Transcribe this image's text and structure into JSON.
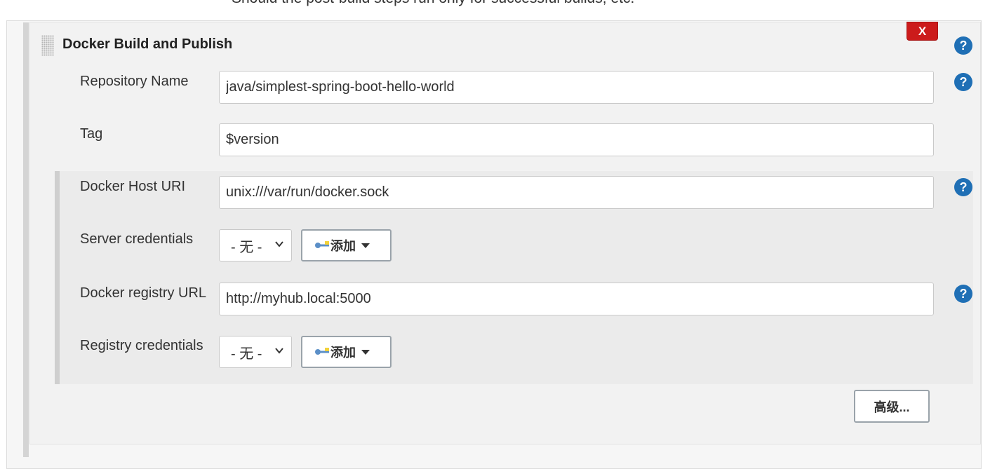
{
  "page_top_text": "Should the post-build steps run only for successful builds, etc.",
  "section": {
    "title": "Docker Build and Publish",
    "delete_label": "X",
    "help_label": "?"
  },
  "fields": {
    "repository_name": {
      "label": "Repository Name",
      "value": "java/simplest-spring-boot-hello-world"
    },
    "tag": {
      "label": "Tag",
      "value": "$version"
    },
    "docker_host_uri": {
      "label": "Docker Host URI",
      "value": "unix:///var/run/docker.sock"
    },
    "server_credentials": {
      "label": "Server credentials",
      "selected": "- 无 -",
      "add_label": "添加"
    },
    "docker_registry_url": {
      "label": "Docker registry URL",
      "value": "http://myhub.local:5000"
    },
    "registry_credentials": {
      "label": "Registry credentials",
      "selected": "- 无 -",
      "add_label": "添加"
    }
  },
  "advanced_label": "高级...",
  "icons": {
    "help": "help-icon",
    "delete": "close-icon",
    "drag": "drag-handle-icon",
    "key": "key-icon",
    "chevron": "chevron-down-icon",
    "caret": "caret-down-icon"
  },
  "colors": {
    "help_blue": "#1f6fb5",
    "delete_red": "#cc1b1b",
    "panel_bg": "#f2f2f2",
    "group_bg": "#ebebeb"
  }
}
